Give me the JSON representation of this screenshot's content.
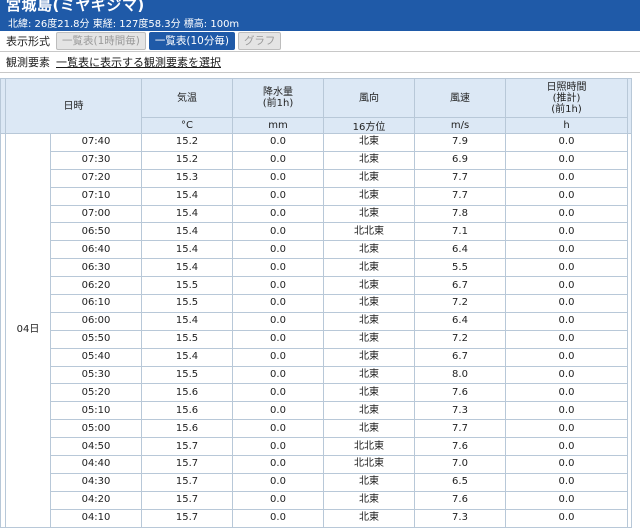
{
  "station": {
    "name": "宮城島(ミヤギジマ)",
    "coords": "北緯: 26度21.8分 東経: 127度58.3分 標高: 100m"
  },
  "format_bar": {
    "label": "表示形式",
    "buttons": [
      "一覧表(1時間毎)",
      "一覧表(10分毎)",
      "グラフ"
    ]
  },
  "element_bar": {
    "label": "観測要素",
    "link": "一覧表に表示する観測要素を選択"
  },
  "table": {
    "headers": [
      {
        "title": "日時",
        "unit": ""
      },
      {
        "title": "気温",
        "unit": "°C"
      },
      {
        "title": "降水量\n(前1h)",
        "unit": "mm"
      },
      {
        "title": "風向",
        "unit": "16方位"
      },
      {
        "title": "風速",
        "unit": "m/s"
      },
      {
        "title": "日照時間\n(推計)\n(前1h)",
        "unit": "h"
      }
    ],
    "day": "04日",
    "rows": [
      [
        "07:40",
        "15.2",
        "0.0",
        "北東",
        "7.9",
        "0.0"
      ],
      [
        "07:30",
        "15.2",
        "0.0",
        "北東",
        "6.9",
        "0.0"
      ],
      [
        "07:20",
        "15.3",
        "0.0",
        "北東",
        "7.7",
        "0.0"
      ],
      [
        "07:10",
        "15.4",
        "0.0",
        "北東",
        "7.7",
        "0.0"
      ],
      [
        "07:00",
        "15.4",
        "0.0",
        "北東",
        "7.8",
        "0.0"
      ],
      [
        "06:50",
        "15.4",
        "0.0",
        "北北東",
        "7.1",
        "0.0"
      ],
      [
        "06:40",
        "15.4",
        "0.0",
        "北東",
        "6.4",
        "0.0"
      ],
      [
        "06:30",
        "15.4",
        "0.0",
        "北東",
        "5.5",
        "0.0"
      ],
      [
        "06:20",
        "15.5",
        "0.0",
        "北東",
        "6.7",
        "0.0"
      ],
      [
        "06:10",
        "15.5",
        "0.0",
        "北東",
        "7.2",
        "0.0"
      ],
      [
        "06:00",
        "15.4",
        "0.0",
        "北東",
        "6.4",
        "0.0"
      ],
      [
        "05:50",
        "15.5",
        "0.0",
        "北東",
        "7.2",
        "0.0"
      ],
      [
        "05:40",
        "15.4",
        "0.0",
        "北東",
        "6.7",
        "0.0"
      ],
      [
        "05:30",
        "15.5",
        "0.0",
        "北東",
        "8.0",
        "0.0"
      ],
      [
        "05:20",
        "15.6",
        "0.0",
        "北東",
        "7.6",
        "0.0"
      ],
      [
        "05:10",
        "15.6",
        "0.0",
        "北東",
        "7.3",
        "0.0"
      ],
      [
        "05:00",
        "15.6",
        "0.0",
        "北東",
        "7.7",
        "0.0"
      ],
      [
        "04:50",
        "15.7",
        "0.0",
        "北北東",
        "7.6",
        "0.0"
      ],
      [
        "04:40",
        "15.7",
        "0.0",
        "北北東",
        "7.0",
        "0.0"
      ],
      [
        "04:30",
        "15.7",
        "0.0",
        "北東",
        "6.5",
        "0.0"
      ],
      [
        "04:20",
        "15.7",
        "0.0",
        "北東",
        "7.6",
        "0.0"
      ],
      [
        "04:10",
        "15.7",
        "0.0",
        "北東",
        "7.3",
        "0.0"
      ]
    ]
  }
}
